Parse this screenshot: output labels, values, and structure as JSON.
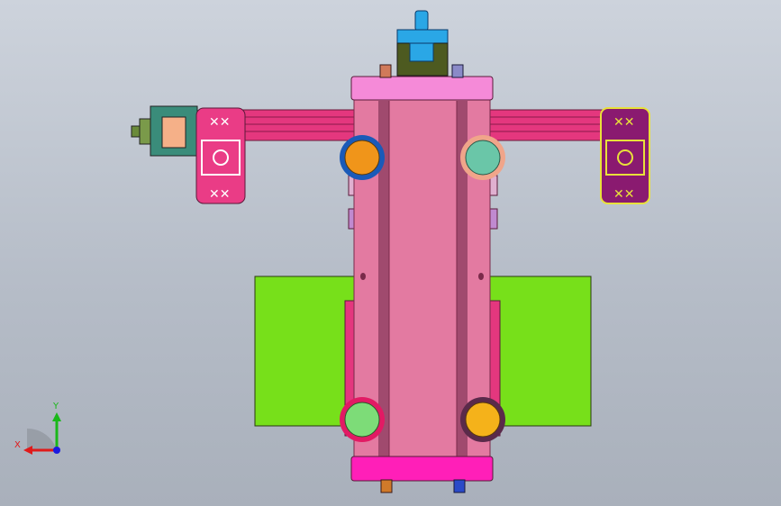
{
  "viewport": {
    "background_top": "#cdd3dc",
    "background_bottom": "#a9b0bb"
  },
  "model": {
    "colors": {
      "main_body": "#e37aa1",
      "main_body_edge": "#7a2a4a",
      "rail": "#a04a6e",
      "top_cap": "#f58ad8",
      "bottom_cap": "#ff1fb8",
      "green_plate": "#77e01a",
      "pink_bars": "#e4377e",
      "left_block": "#ea3c86",
      "right_block": "#8a1a70",
      "right_block_edge": "#e8e13a",
      "top_fitting_blue": "#2aa7e6",
      "top_fitting_olive": "#4d5a20",
      "left_fitting_teal": "#3a8c7a",
      "left_fitting_peach": "#f5b088",
      "port_orange": "#f0951a",
      "port_orange_ring": "#1a5ab8",
      "port_teal": "#6ac6a8",
      "port_teal_ring": "#f0a58a",
      "port_green": "#7ddc78",
      "port_green_ring": "#e21a64",
      "port_yellow": "#f5b21a",
      "port_yellow_ring": "#5a2a4a"
    }
  },
  "triad": {
    "x_label": "X",
    "y_label": "Y",
    "x_color": "#e01a1a",
    "y_color": "#1ab81a",
    "z_color": "#1a1ae0"
  }
}
